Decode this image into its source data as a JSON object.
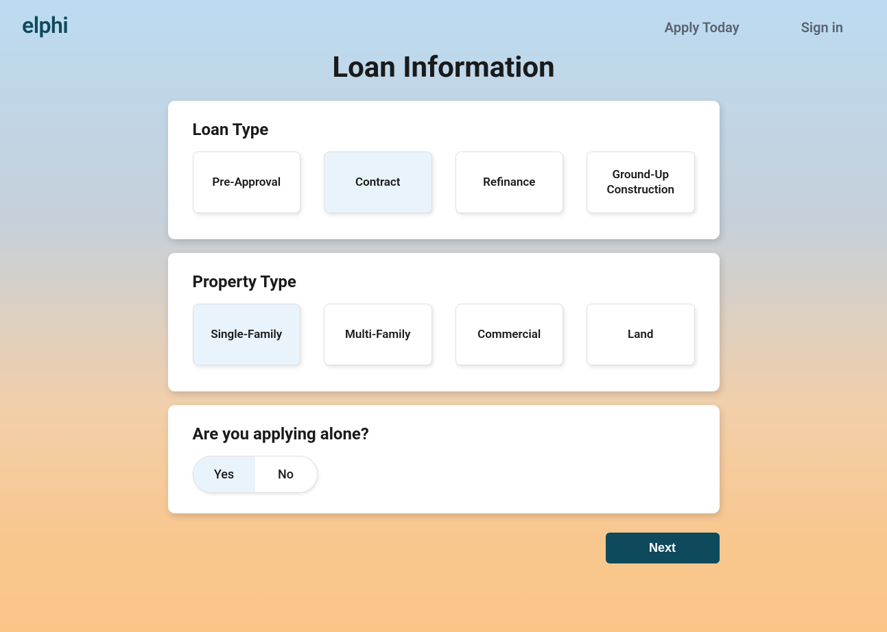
{
  "header": {
    "logo": "elphi",
    "nav": {
      "apply": "Apply Today",
      "signin": "Sign in"
    }
  },
  "page_title": "Loan Information",
  "sections": {
    "loan_type": {
      "title": "Loan Type",
      "options": [
        {
          "label": "Pre-Approval",
          "selected": false
        },
        {
          "label": "Contract",
          "selected": true
        },
        {
          "label": "Refinance",
          "selected": false
        },
        {
          "label": "Ground-Up Construction",
          "selected": false
        }
      ]
    },
    "property_type": {
      "title": "Property Type",
      "options": [
        {
          "label": "Single-Family",
          "selected": true
        },
        {
          "label": "Multi-Family",
          "selected": false
        },
        {
          "label": "Commercial",
          "selected": false
        },
        {
          "label": "Land",
          "selected": false
        }
      ]
    },
    "applying_alone": {
      "title": "Are you applying alone?",
      "options": [
        {
          "label": "Yes",
          "selected": true
        },
        {
          "label": "No",
          "selected": false
        }
      ]
    }
  },
  "actions": {
    "next": "Next"
  }
}
